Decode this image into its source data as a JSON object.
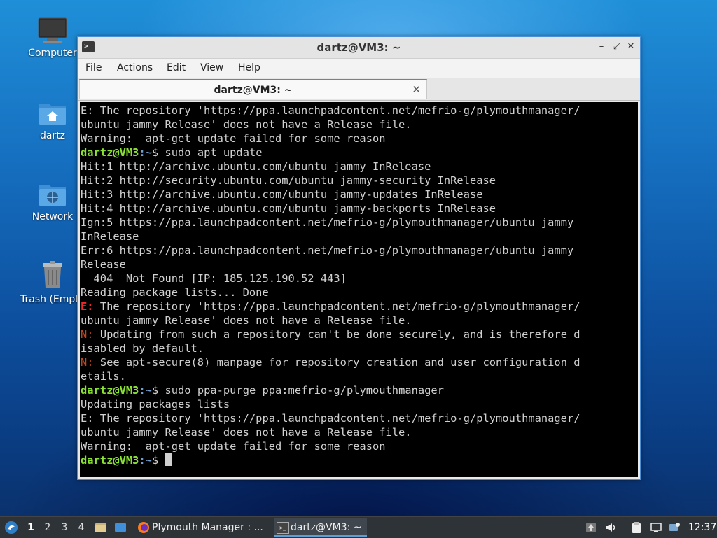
{
  "desktop": {
    "icons": [
      {
        "label": "Computer"
      },
      {
        "label": "dartz"
      },
      {
        "label": "Network"
      },
      {
        "label": "Trash (Empty)"
      }
    ]
  },
  "window": {
    "title": "dartz@VM3: ~",
    "controls": {
      "minimize": "–",
      "maximize": "⤢",
      "close": "✕"
    },
    "menu": [
      "File",
      "Actions",
      "Edit",
      "View",
      "Help"
    ],
    "tab": {
      "title": "dartz@VM3: ~",
      "close": "✕"
    }
  },
  "terminal": {
    "prompt_user": "dartz@VM3",
    "prompt_path": ":~",
    "prompt_sym": "$ ",
    "lines": [
      {
        "t": "E: The repository 'https://ppa.launchpadcontent.net/mefrio-g/plymouthmanager/"
      },
      {
        "t": "ubuntu jammy Release' does not have a Release file."
      },
      {
        "t": "Warning:  apt-get update failed for some reason"
      },
      {
        "cmd": "sudo apt update"
      },
      {
        "t": "Hit:1 http://archive.ubuntu.com/ubuntu jammy InRelease"
      },
      {
        "t": "Hit:2 http://security.ubuntu.com/ubuntu jammy-security InRelease"
      },
      {
        "t": "Hit:3 http://archive.ubuntu.com/ubuntu jammy-updates InRelease"
      },
      {
        "t": "Hit:4 http://archive.ubuntu.com/ubuntu jammy-backports InRelease"
      },
      {
        "t": "Ign:5 https://ppa.launchpadcontent.net/mefrio-g/plymouthmanager/ubuntu jammy"
      },
      {
        "t": "InRelease"
      },
      {
        "t": "Err:6 https://ppa.launchpadcontent.net/mefrio-g/plymouthmanager/ubuntu jammy"
      },
      {
        "t": "Release"
      },
      {
        "t": "  404  Not Found [IP: 185.125.190.52 443]"
      },
      {
        "t": "Reading package lists... Done"
      },
      {
        "tag": "E:",
        "tagType": "E",
        "t": " The repository 'https://ppa.launchpadcontent.net/mefrio-g/plymouthmanager/"
      },
      {
        "t": "ubuntu jammy Release' does not have a Release file."
      },
      {
        "tag": "N:",
        "tagType": "N",
        "t": " Updating from such a repository can't be done securely, and is therefore d"
      },
      {
        "t": "isabled by default."
      },
      {
        "tag": "N:",
        "tagType": "N",
        "t": " See apt-secure(8) manpage for repository creation and user configuration d"
      },
      {
        "t": "etails."
      },
      {
        "cmd": "sudo ppa-purge ppa:mefrio-g/plymouthmanager"
      },
      {
        "t": "Updating packages lists"
      },
      {
        "t": "E: The repository 'https://ppa.launchpadcontent.net/mefrio-g/plymouthmanager/"
      },
      {
        "t": "ubuntu jammy Release' does not have a Release file."
      },
      {
        "t": "Warning:  apt-get update failed for some reason"
      },
      {
        "cmd": "",
        "cursor": true
      }
    ]
  },
  "taskbar": {
    "workspaces": [
      "1",
      "2",
      "3",
      "4"
    ],
    "tasks": [
      {
        "label": "Plymouth Manager : ..."
      },
      {
        "label": "dartz@VM3: ~"
      }
    ],
    "clock": "12:37"
  },
  "colors": {
    "accent": "#3d8fd6",
    "prompt_user": "#8ae234",
    "prompt_path": "#729fcf",
    "error": "#ef2929"
  }
}
